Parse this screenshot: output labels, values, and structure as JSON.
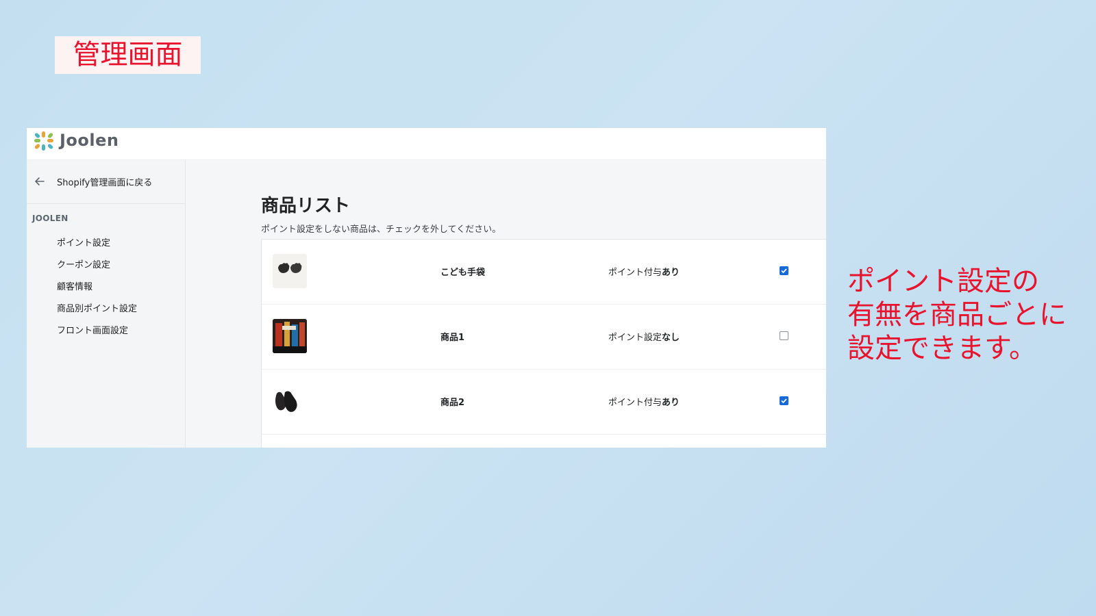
{
  "slide": {
    "title": "管理画面",
    "callout_lines": [
      "ポイント設定の",
      "有無を商品ごとに",
      "設定できます。"
    ]
  },
  "app": {
    "logo_text": "Joolen",
    "back_label": "Shopify管理画面に戻る",
    "section_label": "JOOLEN",
    "nav_items": [
      {
        "label": "ポイント設定"
      },
      {
        "label": "クーポン設定"
      },
      {
        "label": "顧客情報"
      },
      {
        "label": "商品別ポイント設定"
      },
      {
        "label": "フロント画面設定"
      }
    ]
  },
  "main": {
    "title": "商品リスト",
    "subtitle": "ポイント設定をしない商品は、チェックを外してください。",
    "products": [
      {
        "name": "こども手袋",
        "status_prefix": "ポイント付与",
        "status_value": "あり",
        "checked": true,
        "thumb_icon": "gloves-image"
      },
      {
        "name": "商品1",
        "status_prefix": "ポイント設定",
        "status_value": "なし",
        "checked": false,
        "thumb_icon": "product-photo"
      },
      {
        "name": "商品2",
        "status_prefix": "ポイント付与",
        "status_value": "あり",
        "checked": true,
        "thumb_icon": "gloves-image"
      }
    ]
  },
  "colors": {
    "accent_red": "#e8132d",
    "checkbox_blue": "#1769d8"
  }
}
